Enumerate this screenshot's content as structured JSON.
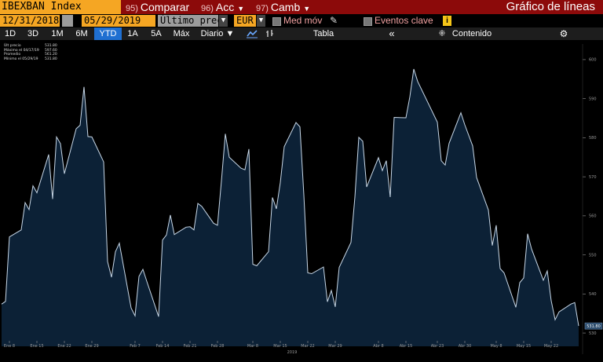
{
  "toolbar": {
    "ticker": "IBEXBAN Index",
    "compare": {
      "num": "95)",
      "label": "Comparar"
    },
    "actions": {
      "num": "96)",
      "label": "Acc"
    },
    "change": {
      "num": "97)",
      "label": "Camb"
    },
    "title": "Gráfico de líneas"
  },
  "controls": {
    "start_date": "12/31/2018",
    "end_date": "05/29/2019",
    "price_field": "Último preci",
    "currency": "EUR",
    "moving_avg_label": "Med móv",
    "key_events_label": "Eventos clave",
    "info_symbol": "i"
  },
  "periods": {
    "tabs": [
      "1D",
      "3D",
      "1M",
      "6M",
      "YTD",
      "1A",
      "5A",
      "Máx"
    ],
    "active": "YTD",
    "frequency": "Diario",
    "table_label": "Tabla",
    "content_label": "Contenido"
  },
  "legend": {
    "rows": [
      {
        "label": "Últ precio",
        "value": "531.80"
      },
      {
        "label": "Máximo el 04/17/19",
        "value": "597.60"
      },
      {
        "label": "Promedio",
        "value": "561.20"
      },
      {
        "label": "Mínimo el 05/29/19",
        "value": "531.80"
      }
    ]
  },
  "chart_data": {
    "type": "area",
    "xlabel": "2019",
    "x_ticks": [
      "Ene 8",
      "Ene 15",
      "Ene 22",
      "Ene 29",
      "Feb 7",
      "Feb 14",
      "Feb 21",
      "Feb 28",
      "Mar 8",
      "Mar 15",
      "Mar 22",
      "Mar 29",
      "Abr 8",
      "Abr 15",
      "Abr 23",
      "Abr 30",
      "May 8",
      "May 15",
      "May 22"
    ],
    "y_ticks": [
      530,
      540,
      550,
      560,
      570,
      580,
      590,
      600
    ],
    "ylim": [
      527,
      603
    ],
    "last_price_label": "531.80",
    "colors": {
      "fill": "#0c2136",
      "line": "#c8d8e8",
      "background": "#000000",
      "tick": "#999999"
    },
    "x": [
      "2019-01-02",
      "2019-01-03",
      "2019-01-04",
      "2019-01-07",
      "2019-01-08",
      "2019-01-09",
      "2019-01-10",
      "2019-01-11",
      "2019-01-14",
      "2019-01-15",
      "2019-01-16",
      "2019-01-17",
      "2019-01-18",
      "2019-01-21",
      "2019-01-22",
      "2019-01-23",
      "2019-01-24",
      "2019-01-25",
      "2019-01-28",
      "2019-01-29",
      "2019-01-30",
      "2019-01-31",
      "2019-02-01",
      "2019-02-04",
      "2019-02-05",
      "2019-02-06",
      "2019-02-07",
      "2019-02-08",
      "2019-02-11",
      "2019-02-12",
      "2019-02-13",
      "2019-02-14",
      "2019-02-15",
      "2019-02-18",
      "2019-02-19",
      "2019-02-20",
      "2019-02-21",
      "2019-02-22",
      "2019-02-25",
      "2019-02-26",
      "2019-02-27",
      "2019-02-28",
      "2019-03-01",
      "2019-03-04",
      "2019-03-05",
      "2019-03-06",
      "2019-03-07",
      "2019-03-08",
      "2019-03-11",
      "2019-03-12",
      "2019-03-13",
      "2019-03-14",
      "2019-03-15",
      "2019-03-18",
      "2019-03-19",
      "2019-03-20",
      "2019-03-21",
      "2019-03-22",
      "2019-03-25",
      "2019-03-26",
      "2019-03-27",
      "2019-03-28",
      "2019-03-29",
      "2019-04-01",
      "2019-04-02",
      "2019-04-03",
      "2019-04-04",
      "2019-04-05",
      "2019-04-08",
      "2019-04-09",
      "2019-04-10",
      "2019-04-11",
      "2019-04-12",
      "2019-04-15",
      "2019-04-16",
      "2019-04-17",
      "2019-04-18",
      "2019-04-23",
      "2019-04-24",
      "2019-04-25",
      "2019-04-26",
      "2019-04-29",
      "2019-04-30",
      "2019-05-02",
      "2019-05-03",
      "2019-05-06",
      "2019-05-07",
      "2019-05-08",
      "2019-05-09",
      "2019-05-10",
      "2019-05-13",
      "2019-05-14",
      "2019-05-15",
      "2019-05-16",
      "2019-05-17",
      "2019-05-20",
      "2019-05-21",
      "2019-05-22",
      "2019-05-23",
      "2019-05-24",
      "2019-05-27",
      "2019-05-28",
      "2019-05-29"
    ],
    "values": [
      537.4,
      538.1,
      554.6,
      556.4,
      563.4,
      561.6,
      567.7,
      565.9,
      575.7,
      564.3,
      580.2,
      578.5,
      570.8,
      582.3,
      583.2,
      593.0,
      580.3,
      580.2,
      573.8,
      548.3,
      544.3,
      550.8,
      553.0,
      536.4,
      534.4,
      544.5,
      546.3,
      543.2,
      534.2,
      553.8,
      555.1,
      560.2,
      555.2,
      557.1,
      557.2,
      556.4,
      563.2,
      562.4,
      558.1,
      557.6,
      568.9,
      581.0,
      575.0,
      572.2,
      571.8,
      577.1,
      547.6,
      547.2,
      550.8,
      564.7,
      561.8,
      568.5,
      577.7,
      583.9,
      582.8,
      565.3,
      545.4,
      545.2,
      546.9,
      538.0,
      540.9,
      536.7,
      546.8,
      553.2,
      564.8,
      580.1,
      579.1,
      567.4,
      574.9,
      571.6,
      574.1,
      564.8,
      585.2,
      585.1,
      590.5,
      597.6,
      594.4,
      584.0,
      574.1,
      573.0,
      578.6,
      586.4,
      583.3,
      577.9,
      569.8,
      561.5,
      552.4,
      557.6,
      546.5,
      545.4,
      536.6,
      542.9,
      544.1,
      555.4,
      551.5,
      543.5,
      545.9,
      538.3,
      533.4,
      535.4,
      537.4,
      537.8,
      531.8
    ]
  }
}
